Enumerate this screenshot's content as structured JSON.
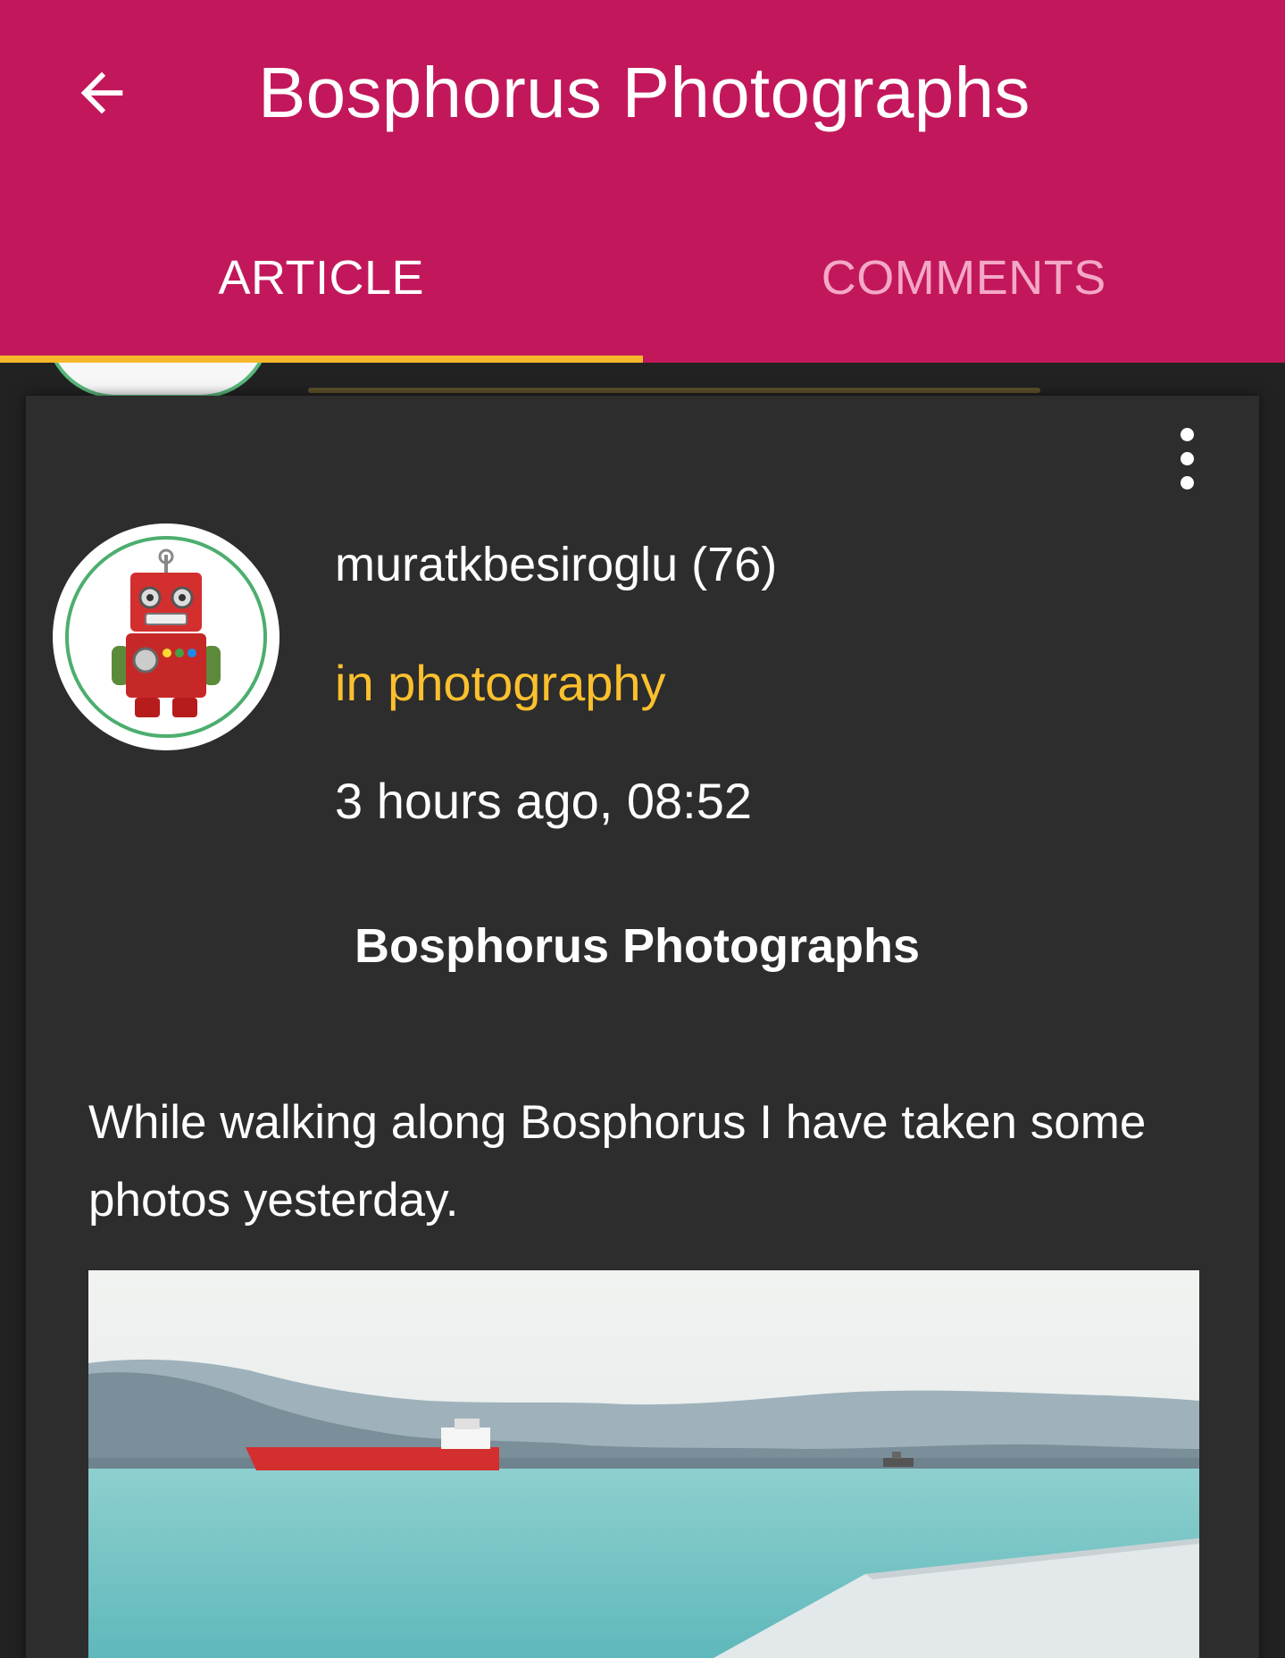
{
  "appbar": {
    "title": "Bosphorus Photographs",
    "back_icon": "arrow-left-icon",
    "color": "#c2185b"
  },
  "tabs": [
    {
      "label": "ARTICLE",
      "active": true
    },
    {
      "label": "COMMENTS",
      "active": false
    }
  ],
  "tab_indicator_color": "#f6b82b",
  "post": {
    "author": "muratkbesiroglu (76)",
    "category": "in photography",
    "time": "3 hours ago, 08:52",
    "title": "Bosphorus Photographs",
    "body": "While walking along Bosphorus I have taken some photos yesterday.",
    "more_icon": "more-vert-icon",
    "avatar_icon": "robot-avatar"
  },
  "colors": {
    "background": "#222222",
    "card": "#2d2d2d",
    "category": "#fbc02d"
  }
}
